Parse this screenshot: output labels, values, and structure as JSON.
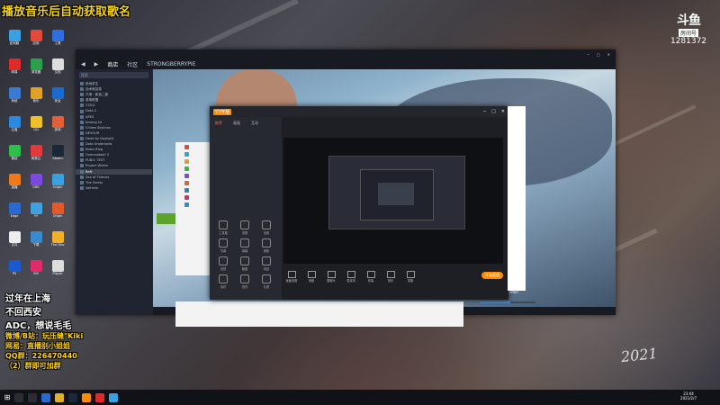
{
  "overlay": {
    "title": "播放音乐后自动获取歌名",
    "streamer": {
      "line1": "过年在上海",
      "line2": "不回西安",
      "line3": "ADC，想说毛毛",
      "weibo": "微博/B站：玩压缝\"Kiki",
      "nickname": "网易：直播别小姐姐",
      "qq_group": "QQ群：226470440",
      "fan_group": "（2）群即可加群"
    },
    "watermark": {
      "logo": "斗鱼",
      "room_label": "房间号",
      "room_number": "1281372"
    }
  },
  "steam": {
    "nav": {
      "back": "◀",
      "forward": "▶",
      "store": "商店",
      "community": "社区",
      "profile": "STRONGBERRYPIE"
    },
    "search_placeholder": "搜索",
    "games": [
      "绝地求生",
      "战术竞技类",
      "只狼：影逝二度",
      "英雄联盟",
      "CSGO",
      "Dota 2",
      "APEX",
      "Among Us",
      "Chilies Skylines",
      "DEVOUR",
      "Dead by Daylight",
      "Dota Underlords",
      "Elden Ring",
      "Overcooked! 2",
      "PUBG: TEST",
      "Project Winter",
      "Raft",
      "Sea of Thieves",
      "The Forest",
      "Valheim"
    ],
    "highlighted_game": "Raft",
    "achievement": "Expert Lurker Hunter!",
    "progress": 0.55
  },
  "yy": {
    "app_name": "YY开播",
    "tabs": [
      "推荐",
      "画面",
      "互动"
    ],
    "tools": [
      "工具箱",
      "录屏",
      "设置",
      "字幕",
      "弹幕",
      "美颜",
      "滤镜",
      "截图",
      "场景",
      "素材",
      "音效",
      "礼物"
    ],
    "bottom_buttons": [
      "画面设置",
      "音频",
      "摄像头",
      "麦克风",
      "伴奏",
      "音乐",
      "录制"
    ],
    "live_button": "开始直播"
  },
  "taskbar": {
    "start": "⊞",
    "time": "23:04",
    "date": "2021/2/7"
  },
  "signature": "2021"
}
